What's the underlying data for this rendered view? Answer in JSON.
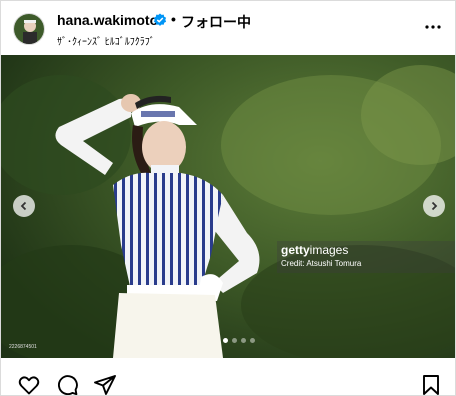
{
  "header": {
    "username": "hana.wakimoto",
    "separator": "•",
    "follow_label": "フォロー中",
    "location": "ｻﾞ･ｸｨｰﾝｽﾞ ﾋﾙｺﾞﾙﾌｸﾗﾌﾞ",
    "icons": {
      "avatar": "avatar",
      "verified": "verified-badge-icon",
      "more": "more-options-icon"
    },
    "colors": {
      "verified": "#0095f6",
      "text": "#000000"
    }
  },
  "photo": {
    "watermark_brand": "getty",
    "watermark_brand_suffix": "images",
    "watermark_credit": "Credit: Atsushi Tomura",
    "photo_id": "2226874501",
    "carousel": {
      "count": 4,
      "active_index": 0
    },
    "icons": {
      "prev": "chevron-left-icon",
      "next": "chevron-right-icon"
    }
  },
  "actions": {
    "icons": [
      "like-heart-icon",
      "comment-icon",
      "share-icon",
      "save-bookmark-icon"
    ]
  }
}
